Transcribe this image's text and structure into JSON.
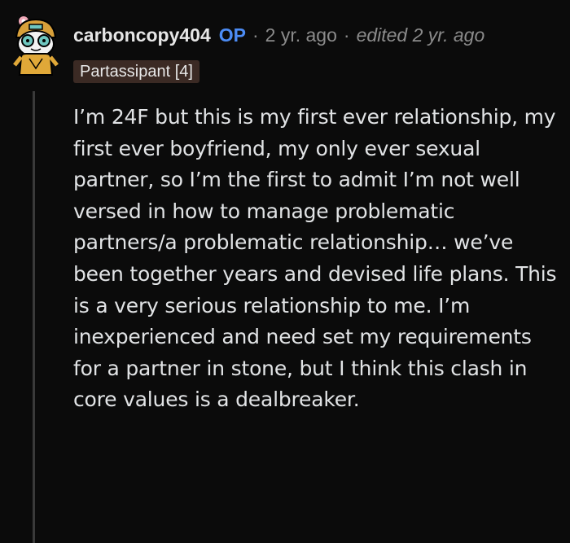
{
  "comment": {
    "username": "carboncopy404",
    "op_badge": "OP",
    "separator": "·",
    "time_ago": "2 yr. ago",
    "edited": "edited 2 yr. ago",
    "flair": "Partassipant [4]",
    "avatar_icon": "snoo-avatar-icon",
    "body": "I’m 24F but this is my first ever relationship, my first ever boyfriend, my only ever sexual partner, so I’m the first to admit I’m not well versed in how to manage problematic partners/a problematic relationship… we’ve been together years and devised life plans. This is a very serious relationship to me. I’m inexperienced and need set my requirements for a partner in stone, but I think this clash in core values is a dealbreaker."
  },
  "colors": {
    "background": "#0b0b0b",
    "op_badge": "#4c8cf5",
    "flair_bg": "#3b2a24",
    "meta_text": "#8b8b8b"
  }
}
